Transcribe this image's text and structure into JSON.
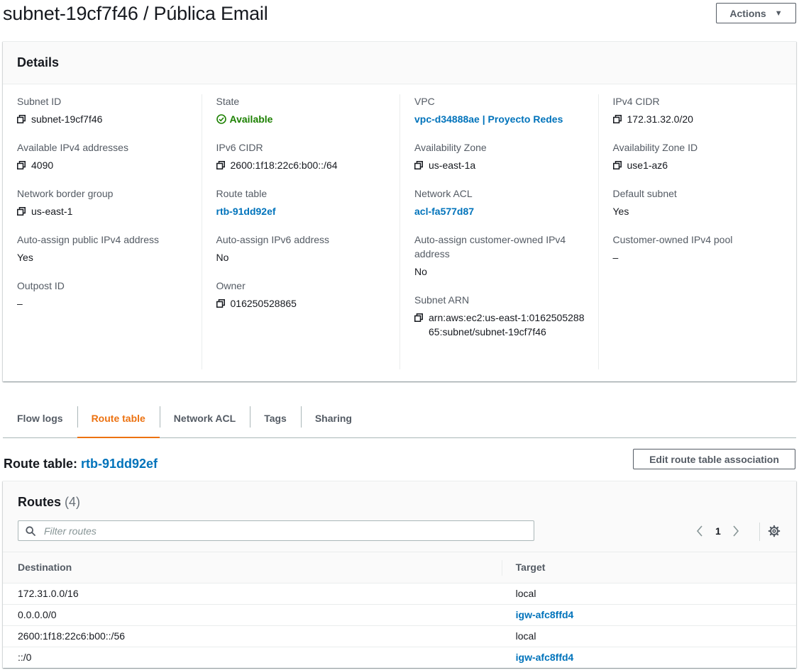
{
  "page": {
    "title": "subnet-19cf7f46 / Pública Email"
  },
  "actions_label": "Actions",
  "details": {
    "heading": "Details",
    "columns": [
      [
        {
          "label": "Subnet ID",
          "value": "subnet-19cf7f46",
          "copy": true
        },
        {
          "label": "Available IPv4 addresses",
          "value": "4090",
          "copy": true
        },
        {
          "label": "Network border group",
          "value": "us-east-1",
          "copy": true
        },
        {
          "label": "Auto-assign public IPv4 address",
          "value": "Yes"
        },
        {
          "label": "Outpost ID",
          "value": "–"
        }
      ],
      [
        {
          "label": "State",
          "value": "Available",
          "status": "ok"
        },
        {
          "label": "IPv6 CIDR",
          "value": "2600:1f18:22c6:b00::/64",
          "copy": true
        },
        {
          "label": "Route table",
          "value": "rtb-91dd92ef",
          "link": true
        },
        {
          "label": "Auto-assign IPv6 address",
          "value": "No"
        },
        {
          "label": "Owner",
          "value": "016250528865",
          "copy": true
        }
      ],
      [
        {
          "label": "VPC",
          "value": "vpc-d34888ae | Proyecto Redes",
          "link": true
        },
        {
          "label": "Availability Zone",
          "value": "us-east-1a",
          "copy": true
        },
        {
          "label": "Network ACL",
          "value": "acl-fa577d87",
          "link": true
        },
        {
          "label": "Auto-assign customer-owned IPv4 address",
          "value": "No"
        },
        {
          "label": "Subnet ARN",
          "value": "arn:aws:ec2:us-east-1:016250528865:subnet/subnet-19cf7f46",
          "copy": true
        }
      ],
      [
        {
          "label": "IPv4 CIDR",
          "value": "172.31.32.0/20",
          "copy": true
        },
        {
          "label": "Availability Zone ID",
          "value": "use1-az6",
          "copy": true
        },
        {
          "label": "Default subnet",
          "value": "Yes"
        },
        {
          "label": "Customer-owned IPv4 pool",
          "value": "–"
        }
      ]
    ]
  },
  "tabs": [
    {
      "label": "Flow logs",
      "active": false
    },
    {
      "label": "Route table",
      "active": true
    },
    {
      "label": "Network ACL",
      "active": false
    },
    {
      "label": "Tags",
      "active": false
    },
    {
      "label": "Sharing",
      "active": false
    }
  ],
  "route_table": {
    "heading_prefix": "Route table: ",
    "id": "rtb-91dd92ef",
    "edit_label": "Edit route table association"
  },
  "routes": {
    "title": "Routes",
    "count": "(4)",
    "filter_placeholder": "Filter routes",
    "page": "1",
    "columns": [
      "Destination",
      "Target"
    ],
    "rows": [
      {
        "destination": "172.31.0.0/16",
        "target": "local",
        "target_link": false
      },
      {
        "destination": "0.0.0.0/0",
        "target": "igw-afc8ffd4",
        "target_link": true
      },
      {
        "destination": "2600:1f18:22c6:b00::/56",
        "target": "local",
        "target_link": false
      },
      {
        "destination": "::/0",
        "target": "igw-afc8ffd4",
        "target_link": true
      }
    ]
  },
  "colors": {
    "link": "#0073bb",
    "active_tab": "#ec7211",
    "status_ok": "#1d8102",
    "text": "#16191f",
    "muted": "#545b64"
  }
}
